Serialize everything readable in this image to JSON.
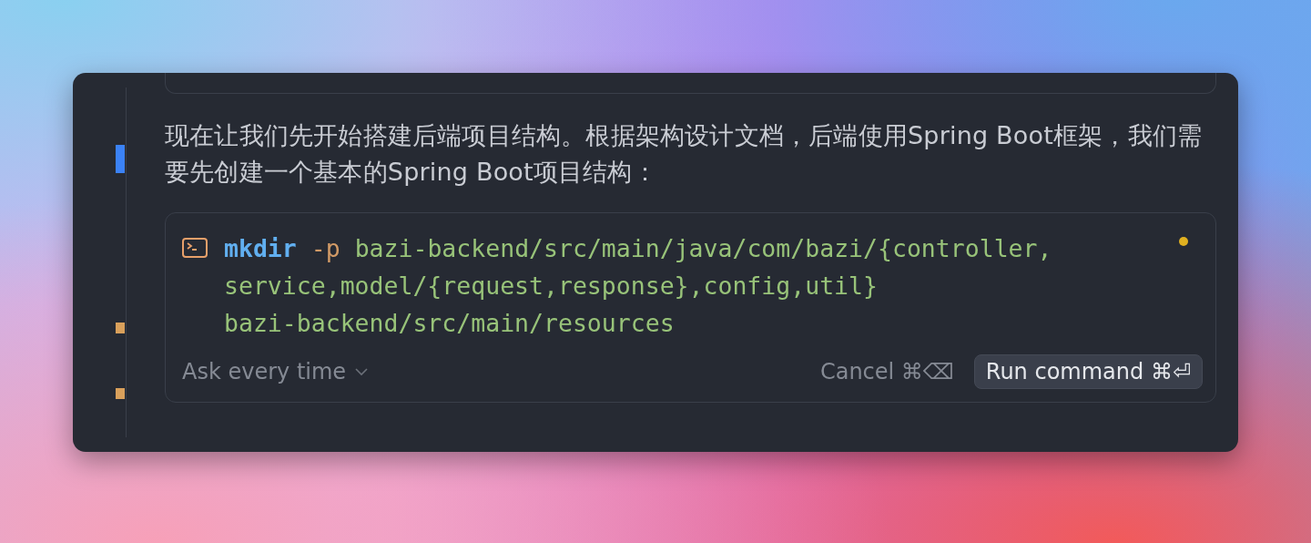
{
  "gutter_marks": [
    {
      "kind": "bar",
      "color": "#3b82f6"
    },
    {
      "kind": "square",
      "color": "#d9a05b"
    },
    {
      "kind": "square",
      "color": "#d9a05b"
    }
  ],
  "message": "现在让我们先开始搭建后端项目结构。根据架构设计文档，后端使用Spring Boot框架，我们需要先创建一个基本的Spring Boot项目结构：",
  "command_card": {
    "program": "mkdir",
    "flag": "-p",
    "lines": [
      "bazi-backend/src/main/java/com/bazi/{controller,",
      "service,model/{request,response},config,util}",
      "bazi-backend/src/main/resources"
    ],
    "status_indicator": true,
    "approval_mode": "Ask every time",
    "cancel": "Cancel ⌘⌫",
    "run": "Run command ⌘⏎"
  }
}
